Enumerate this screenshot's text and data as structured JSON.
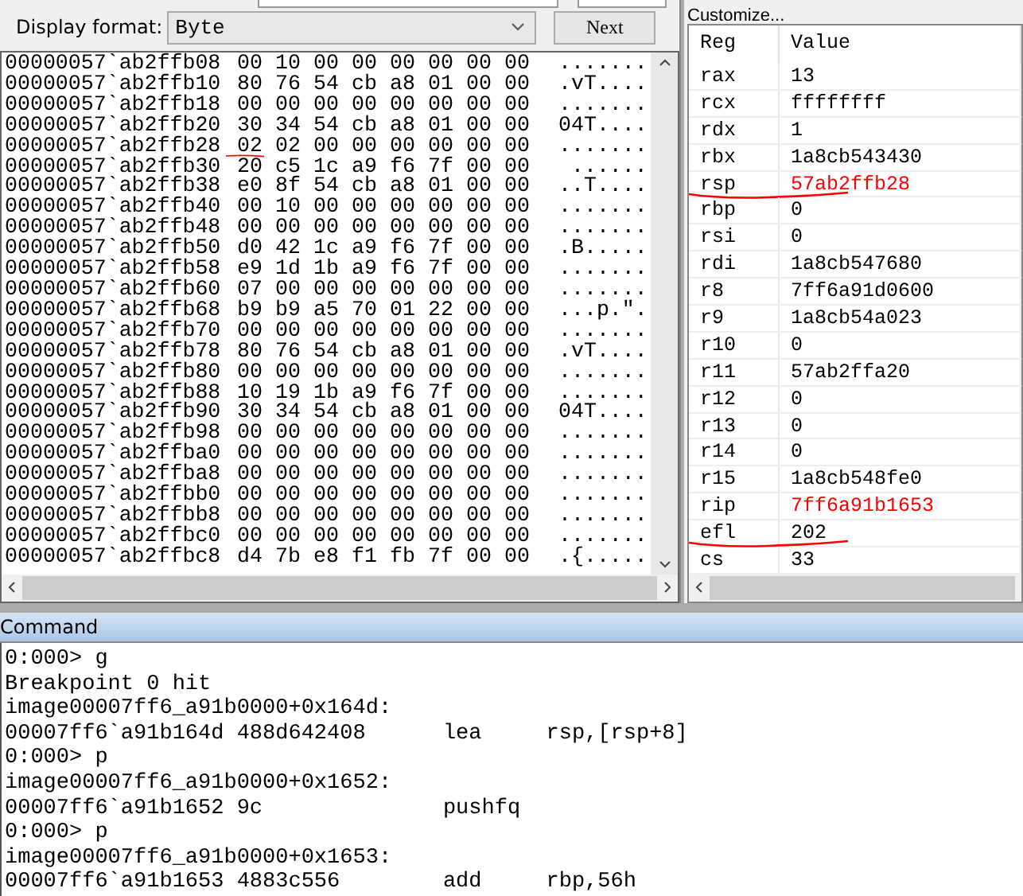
{
  "memory": {
    "display_format_label": "Display format:",
    "display_format": "Byte",
    "next_button": "Next",
    "rows": [
      {
        "address": "00000057`ab2ffb08",
        "bytes": [
          "00",
          "10",
          "00",
          "00",
          "00",
          "00",
          "00",
          "00"
        ],
        "ascii": ".......",
        "marked": false
      },
      {
        "address": "00000057`ab2ffb10",
        "bytes": [
          "80",
          "76",
          "54",
          "cb",
          "a8",
          "01",
          "00",
          "00"
        ],
        "ascii": ".vT....",
        "marked": false
      },
      {
        "address": "00000057`ab2ffb18",
        "bytes": [
          "00",
          "00",
          "00",
          "00",
          "00",
          "00",
          "00",
          "00"
        ],
        "ascii": ".......",
        "marked": false
      },
      {
        "address": "00000057`ab2ffb20",
        "bytes": [
          "30",
          "34",
          "54",
          "cb",
          "a8",
          "01",
          "00",
          "00"
        ],
        "ascii": "04T....",
        "marked": false
      },
      {
        "address": "00000057`ab2ffb28",
        "bytes": [
          "02",
          "02",
          "00",
          "00",
          "00",
          "00",
          "00",
          "00"
        ],
        "ascii": ".......",
        "marked": true
      },
      {
        "address": "00000057`ab2ffb30",
        "bytes": [
          "20",
          "c5",
          "1c",
          "a9",
          "f6",
          "7f",
          "00",
          "00"
        ],
        "ascii": " ......",
        "marked": false
      },
      {
        "address": "00000057`ab2ffb38",
        "bytes": [
          "e0",
          "8f",
          "54",
          "cb",
          "a8",
          "01",
          "00",
          "00"
        ],
        "ascii": "..T....",
        "marked": false
      },
      {
        "address": "00000057`ab2ffb40",
        "bytes": [
          "00",
          "10",
          "00",
          "00",
          "00",
          "00",
          "00",
          "00"
        ],
        "ascii": ".......",
        "marked": false
      },
      {
        "address": "00000057`ab2ffb48",
        "bytes": [
          "00",
          "00",
          "00",
          "00",
          "00",
          "00",
          "00",
          "00"
        ],
        "ascii": ".......",
        "marked": false
      },
      {
        "address": "00000057`ab2ffb50",
        "bytes": [
          "d0",
          "42",
          "1c",
          "a9",
          "f6",
          "7f",
          "00",
          "00"
        ],
        "ascii": ".B.....",
        "marked": false
      },
      {
        "address": "00000057`ab2ffb58",
        "bytes": [
          "e9",
          "1d",
          "1b",
          "a9",
          "f6",
          "7f",
          "00",
          "00"
        ],
        "ascii": ".......",
        "marked": false
      },
      {
        "address": "00000057`ab2ffb60",
        "bytes": [
          "07",
          "00",
          "00",
          "00",
          "00",
          "00",
          "00",
          "00"
        ],
        "ascii": ".......",
        "marked": false
      },
      {
        "address": "00000057`ab2ffb68",
        "bytes": [
          "b9",
          "b9",
          "a5",
          "70",
          "01",
          "22",
          "00",
          "00"
        ],
        "ascii": "...p.\".",
        "marked": false
      },
      {
        "address": "00000057`ab2ffb70",
        "bytes": [
          "00",
          "00",
          "00",
          "00",
          "00",
          "00",
          "00",
          "00"
        ],
        "ascii": ".......",
        "marked": false
      },
      {
        "address": "00000057`ab2ffb78",
        "bytes": [
          "80",
          "76",
          "54",
          "cb",
          "a8",
          "01",
          "00",
          "00"
        ],
        "ascii": ".vT....",
        "marked": false
      },
      {
        "address": "00000057`ab2ffb80",
        "bytes": [
          "00",
          "00",
          "00",
          "00",
          "00",
          "00",
          "00",
          "00"
        ],
        "ascii": ".......",
        "marked": false
      },
      {
        "address": "00000057`ab2ffb88",
        "bytes": [
          "10",
          "19",
          "1b",
          "a9",
          "f6",
          "7f",
          "00",
          "00"
        ],
        "ascii": ".......",
        "marked": false
      },
      {
        "address": "00000057`ab2ffb90",
        "bytes": [
          "30",
          "34",
          "54",
          "cb",
          "a8",
          "01",
          "00",
          "00"
        ],
        "ascii": "04T....",
        "marked": false
      },
      {
        "address": "00000057`ab2ffb98",
        "bytes": [
          "00",
          "00",
          "00",
          "00",
          "00",
          "00",
          "00",
          "00"
        ],
        "ascii": ".......",
        "marked": false
      },
      {
        "address": "00000057`ab2ffba0",
        "bytes": [
          "00",
          "00",
          "00",
          "00",
          "00",
          "00",
          "00",
          "00"
        ],
        "ascii": ".......",
        "marked": false
      },
      {
        "address": "00000057`ab2ffba8",
        "bytes": [
          "00",
          "00",
          "00",
          "00",
          "00",
          "00",
          "00",
          "00"
        ],
        "ascii": ".......",
        "marked": false
      },
      {
        "address": "00000057`ab2ffbb0",
        "bytes": [
          "00",
          "00",
          "00",
          "00",
          "00",
          "00",
          "00",
          "00"
        ],
        "ascii": ".......",
        "marked": false
      },
      {
        "address": "00000057`ab2ffbb8",
        "bytes": [
          "00",
          "00",
          "00",
          "00",
          "00",
          "00",
          "00",
          "00"
        ],
        "ascii": ".......",
        "marked": false
      },
      {
        "address": "00000057`ab2ffbc0",
        "bytes": [
          "00",
          "00",
          "00",
          "00",
          "00",
          "00",
          "00",
          "00"
        ],
        "ascii": ".......",
        "marked": false
      },
      {
        "address": "00000057`ab2ffbc8",
        "bytes": [
          "d4",
          "7b",
          "e8",
          "f1",
          "fb",
          "7f",
          "00",
          "00"
        ],
        "ascii": ".{.....",
        "marked": false
      }
    ]
  },
  "registers": {
    "customize_button": "Customize...",
    "columns": [
      "Reg",
      "Value"
    ],
    "rows": [
      {
        "reg": "rax",
        "value": "13",
        "changed": false,
        "marked": false
      },
      {
        "reg": "rcx",
        "value": "ffffffff",
        "changed": false,
        "marked": false
      },
      {
        "reg": "rdx",
        "value": "1",
        "changed": false,
        "marked": false
      },
      {
        "reg": "rbx",
        "value": "1a8cb543430",
        "changed": false,
        "marked": false
      },
      {
        "reg": "rsp",
        "value": "57ab2ffb28",
        "changed": true,
        "marked": true
      },
      {
        "reg": "rbp",
        "value": "0",
        "changed": false,
        "marked": false
      },
      {
        "reg": "rsi",
        "value": "0",
        "changed": false,
        "marked": false
      },
      {
        "reg": "rdi",
        "value": "1a8cb547680",
        "changed": false,
        "marked": false
      },
      {
        "reg": "r8",
        "value": "7ff6a91d0600",
        "changed": false,
        "marked": false
      },
      {
        "reg": "r9",
        "value": "1a8cb54a023",
        "changed": false,
        "marked": false
      },
      {
        "reg": "r10",
        "value": "0",
        "changed": false,
        "marked": false
      },
      {
        "reg": "r11",
        "value": "57ab2ffa20",
        "changed": false,
        "marked": false
      },
      {
        "reg": "r12",
        "value": "0",
        "changed": false,
        "marked": false
      },
      {
        "reg": "r13",
        "value": "0",
        "changed": false,
        "marked": false
      },
      {
        "reg": "r14",
        "value": "0",
        "changed": false,
        "marked": false
      },
      {
        "reg": "r15",
        "value": "1a8cb548fe0",
        "changed": false,
        "marked": false
      },
      {
        "reg": "rip",
        "value": "7ff6a91b1653",
        "changed": true,
        "marked": false
      },
      {
        "reg": "efl",
        "value": "202",
        "changed": false,
        "marked": true
      },
      {
        "reg": "cs",
        "value": "33",
        "changed": false,
        "marked": false
      }
    ]
  },
  "command": {
    "title": "Command",
    "lines": [
      "0:000> g",
      "Breakpoint 0 hit",
      "image00007ff6_a91b0000+0x164d:",
      "00007ff6`a91b164d 488d642408      lea     rsp,[rsp+8]",
      "0:000> p",
      "image00007ff6_a91b0000+0x1652:",
      "00007ff6`a91b1652 9c              pushfq",
      "0:000> p",
      "image00007ff6_a91b0000+0x1653:",
      "00007ff6`a91b1653 4883c556        add     rbp,56h"
    ]
  }
}
